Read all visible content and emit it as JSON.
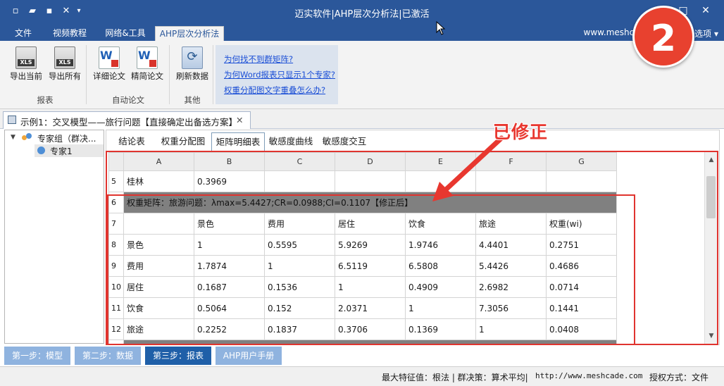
{
  "window": {
    "title": "迈实软件|AHP层次分析法|已激活",
    "quick_access_icons": [
      "new-document-icon",
      "open-folder-icon",
      "save-icon",
      "tools-icon",
      "dropdown-icon"
    ],
    "controls": {
      "maximize": "□",
      "close": "✕"
    }
  },
  "menu": {
    "tabs": [
      "文件",
      "视频教程",
      "网络&工具",
      "AHP层次分析法"
    ],
    "active": "AHP层次分析法",
    "site": "www.meshcade.c",
    "options": "选项 ▾"
  },
  "ribbon": {
    "groups": [
      {
        "label": "报表",
        "buttons": [
          {
            "label": "导出当前",
            "icon": "excel-export-icon"
          },
          {
            "label": "导出所有",
            "icon": "excel-export-all-icon"
          }
        ]
      },
      {
        "label": "自动论文",
        "buttons": [
          {
            "label": "详细论文",
            "icon": "word-detailed-icon"
          },
          {
            "label": "精简论文",
            "icon": "word-brief-icon"
          }
        ]
      },
      {
        "label": "其他",
        "buttons": [
          {
            "label": "刷新数据",
            "icon": "refresh-icon"
          }
        ]
      }
    ],
    "links": [
      "为何找不到群矩阵?",
      "为何Word报表只显示1个专家?",
      "权重分配图文字重叠怎么办?"
    ]
  },
  "document_tab": {
    "title": "示例1：交叉模型——旅行问题【直接确定出备选方案】",
    "close": "✕"
  },
  "tree": {
    "root": "专家组（群决...",
    "child": "专家1"
  },
  "subtabs": [
    "结论表",
    "权重分配图",
    "矩阵明细表",
    "敏感度曲线",
    "敏感度交互"
  ],
  "active_subtab": "矩阵明细表",
  "grid": {
    "columns": [
      "A",
      "B",
      "C",
      "D",
      "E",
      "F",
      "G"
    ],
    "row5": {
      "num": "5",
      "cells": [
        "桂林",
        "0.3969",
        "",
        "",
        "",
        "",
        ""
      ]
    },
    "row6": {
      "num": "6",
      "text": "权重矩阵：旅游问题：λmax=5.4427;CR=0.0988;CI=0.1107【修正后】"
    },
    "row7": {
      "num": "7",
      "cells": [
        "",
        "景色",
        "费用",
        "居住",
        "饮食",
        "旅途",
        "权重(wi)"
      ]
    },
    "rows": [
      {
        "num": "8",
        "cells": [
          "景色",
          "1",
          "0.5595",
          "5.9269",
          "1.9746",
          "4.4401",
          "0.2751"
        ]
      },
      {
        "num": "9",
        "cells": [
          "费用",
          "1.7874",
          "1",
          "6.5119",
          "6.5808",
          "5.4426",
          "0.4686"
        ]
      },
      {
        "num": "10",
        "cells": [
          "居住",
          "0.1687",
          "0.1536",
          "1",
          "0.4909",
          "2.6982",
          "0.0714"
        ]
      },
      {
        "num": "11",
        "cells": [
          "饮食",
          "0.5064",
          "0.152",
          "2.0371",
          "1",
          "7.3056",
          "0.1441"
        ]
      },
      {
        "num": "12",
        "cells": [
          "旅途",
          "0.2252",
          "0.1837",
          "0.3706",
          "0.1369",
          "1",
          "0.0408"
        ]
      }
    ]
  },
  "annotation": {
    "label": "已修正",
    "badge": "2",
    "color": "#e0342f"
  },
  "steps": [
    {
      "label": "第一步：模型",
      "color": "#8fb3df"
    },
    {
      "label": "第二步：数据",
      "color": "#8fb3df"
    },
    {
      "label": "第三步：报表",
      "color": "#1f5fa8"
    },
    {
      "label": "AHP用户手册",
      "color": "#8fb3df"
    }
  ],
  "status": {
    "info": "最大特征值：根法 | 群决策：算术平均|",
    "url": "http://www.meshcade.com",
    "license": "授权方式：文件"
  }
}
